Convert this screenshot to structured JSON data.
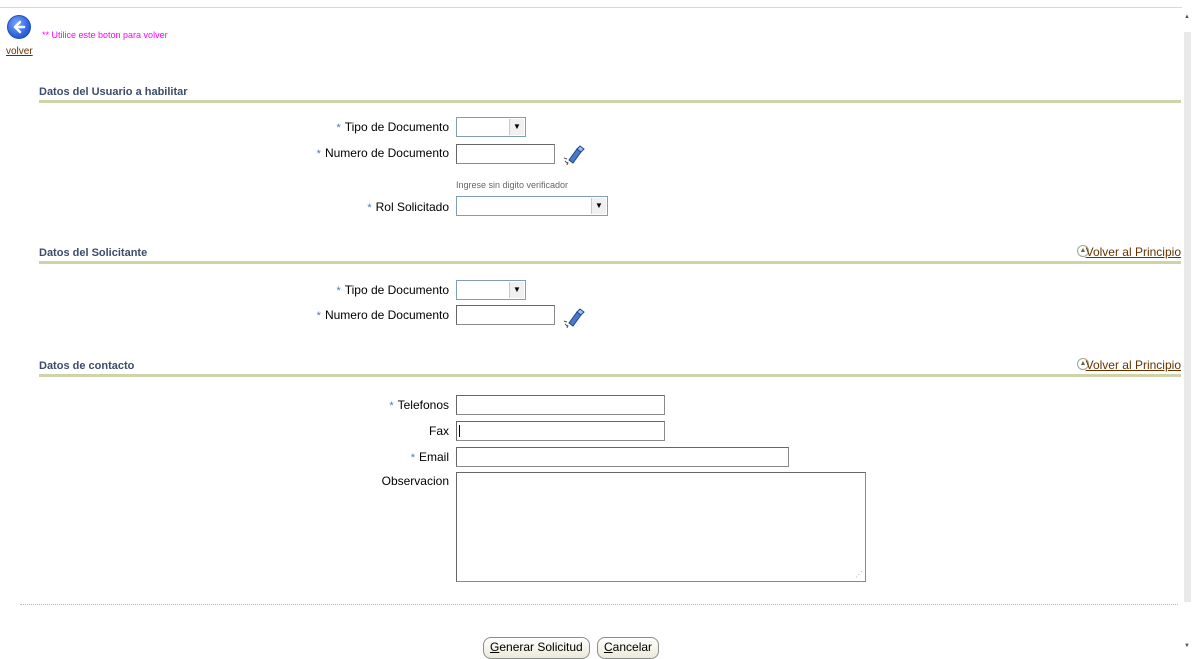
{
  "nav": {
    "back_link": "volver",
    "back_hint": "** Utilice este boton para volver"
  },
  "sections": {
    "usuario": {
      "title": "Datos del Usuario a habilitar",
      "tipo_doc_label": "Tipo de Documento",
      "tipo_doc_value": "",
      "num_doc_label": "Numero de Documento",
      "num_doc_value": "",
      "num_doc_hint": "Ingrese sin digito verificador",
      "rol_label": "Rol Solicitado",
      "rol_value": ""
    },
    "solicitante": {
      "title": "Datos del Solicitante",
      "back_to_top": "Volver al Principio",
      "tipo_doc_label": "Tipo de Documento",
      "tipo_doc_value": "",
      "num_doc_label": "Numero de Documento",
      "num_doc_value": ""
    },
    "contacto": {
      "title": "Datos de contacto",
      "back_to_top": "Volver al Principio",
      "telefonos_label": "Telefonos",
      "telefonos_value": "",
      "fax_label": "Fax",
      "fax_value": "",
      "email_label": "Email",
      "email_value": "",
      "observacion_label": "Observacion",
      "observacion_value": ""
    }
  },
  "required_marker": "*",
  "buttons": {
    "submit_rest": "enerar Solicitud",
    "submit_key": "G",
    "cancel_rest": "ancelar",
    "cancel_key": "C"
  },
  "icons": {
    "back": "back-arrow-icon",
    "search": "flashlight-search-icon",
    "up": "chevron-up-icon"
  },
  "colors": {
    "hint_magenta": "#ff00ff",
    "section_title": "#3c4c6c",
    "section_rule": "#cfd3a8",
    "link_brown": "#663300",
    "required_star": "#4c7ab6"
  }
}
